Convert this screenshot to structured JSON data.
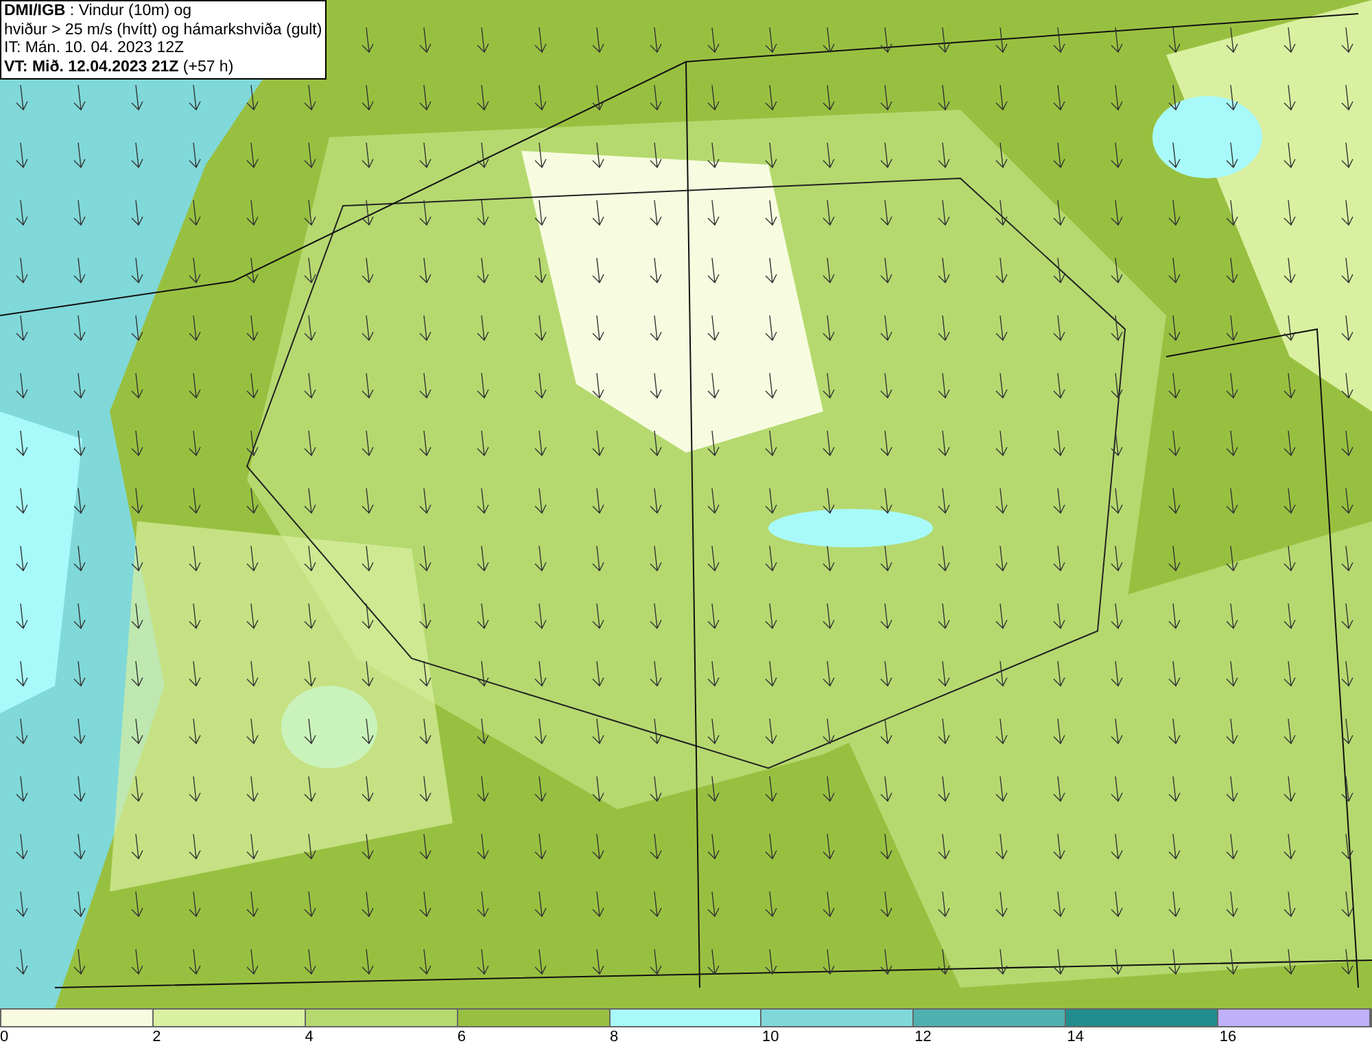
{
  "header": {
    "lines": [
      "**DMI/IGB** : Vindur (10m) og",
      "hviður > 25 m/s (hvítt) og hámarkshviða (gult)",
      "IT: Mán. 10. 04. 2023 12Z",
      "**VT: Mið. 12.04.2023 21Z** (+57 h)"
    ]
  },
  "legend": {
    "bins": [
      {
        "color": "#f7fce0",
        "label": "0"
      },
      {
        "color": "#d9f0a0",
        "label": "2"
      },
      {
        "color": "#b5d96f",
        "label": "4"
      },
      {
        "color": "#98c040",
        "label": "6"
      },
      {
        "color": "#a8fafa",
        "label": "8"
      },
      {
        "color": "#80d8d8",
        "label": "10"
      },
      {
        "color": "#50b0b0",
        "label": "12"
      },
      {
        "color": "#218c8c",
        "label": "14"
      },
      {
        "color": "#c0b0f8",
        "label": "16"
      }
    ]
  }
}
